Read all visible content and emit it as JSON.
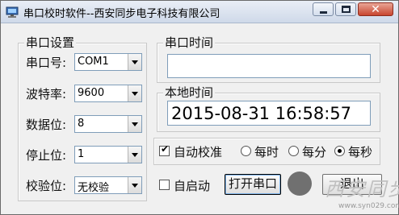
{
  "window": {
    "title": "串口校时软件--西安同步电子科技有限公司",
    "close_glyph": "✕"
  },
  "serial_settings": {
    "group_title": "串口设置",
    "port_label": "串口号:",
    "port_value": "COM1",
    "baud_label": "波特率:",
    "baud_value": "9600",
    "databits_label": "数据位:",
    "databits_value": "8",
    "stopbits_label": "停止位:",
    "stopbits_value": "1",
    "parity_label": "校验位:",
    "parity_value": "无校验"
  },
  "serial_time": {
    "group_title": "串口时间",
    "value": ""
  },
  "local_time": {
    "group_title": "本地时间",
    "value": "2015-08-31 16:58:57"
  },
  "auto_sync": {
    "checkbox_label": "自动校准",
    "checked": true,
    "check_glyph": "✔",
    "options": [
      {
        "label": "每时",
        "selected": false
      },
      {
        "label": "每分",
        "selected": false
      },
      {
        "label": "每秒",
        "selected": true
      }
    ]
  },
  "controls": {
    "autostart_label": "自启动",
    "autostart_checked": false,
    "open_port_label": "打开串口",
    "exit_label": "退出",
    "status_color": "#707070"
  },
  "watermark": {
    "logo_text": "西安同步",
    "url": "www.syn029.com"
  }
}
